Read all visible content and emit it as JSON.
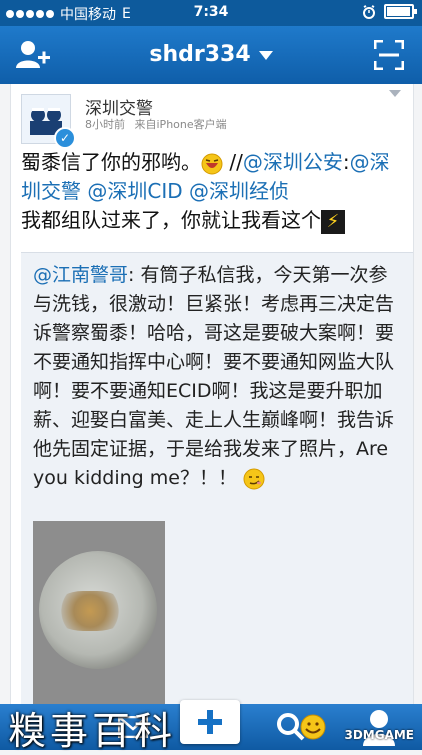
{
  "status_bar": {
    "carrier": "中国移动",
    "network": "E",
    "time": "7:34",
    "signal_dots": 5,
    "battery_level": 0.95
  },
  "nav": {
    "title": "shdr334"
  },
  "post": {
    "author": "深圳交警",
    "time_ago": "8小时前",
    "source": "来自iPhone客户端",
    "text_part1": "蜀黍信了你的邪哟。",
    "text_part2": " //",
    "mention1": "@深圳公安",
    "colon1": ":",
    "mention2": "@深圳交警",
    "mention3": "@深圳CID",
    "mention4": "@深圳经侦",
    "text_part3": "我都组队过来了，你就让我看这个"
  },
  "retweet": {
    "author_mention": "@江南警哥",
    "text": ": 有筒子私信我，今天第一次参与洗钱，很激动！巨紧张！考虑再三决定告诉警察蜀黍！哈哈，哥这是要破大案啊！要不要通知指挥中心啊！要不要通知网监大队啊！要不要通知ECID啊！我这是要升职加薪、迎娶白富美、走上人生巅峰啊！我告诉他先固定证据，于是给我发来了照片，Are you kidding me？！！"
  },
  "watermark": "糗事百科",
  "site_logo": "3DMGAME",
  "colors": {
    "nav_blue": "#1f7acb",
    "link_blue": "#1b6fb5",
    "tab_blue": "#0f5aa3"
  },
  "icons": {
    "add_friend": "add-user-icon",
    "scan": "scan-icon",
    "verified": "verified-badge-icon",
    "message": "mail-icon",
    "compose": "plus-icon",
    "discover": "search-icon",
    "profile": "user-icon"
  }
}
